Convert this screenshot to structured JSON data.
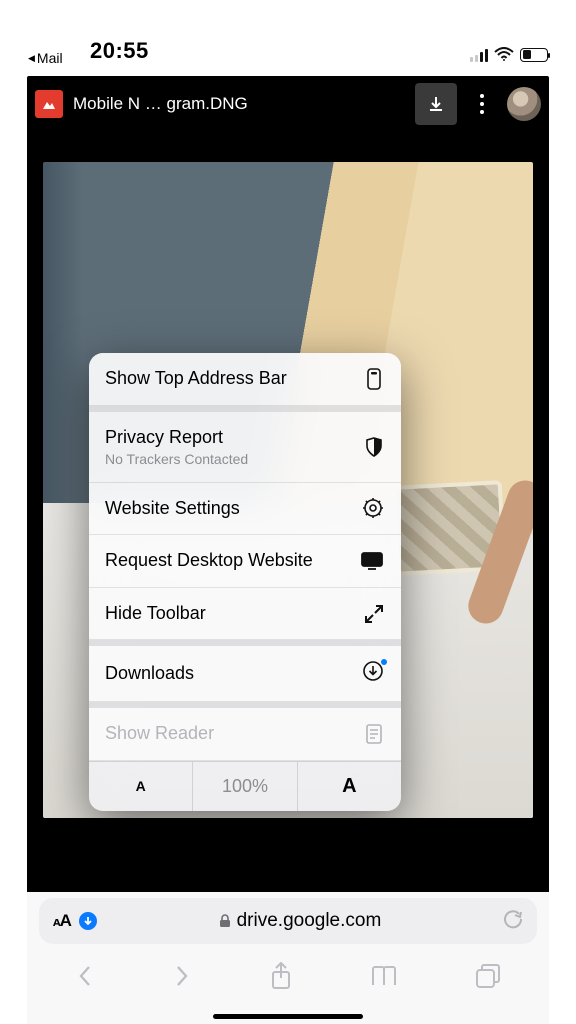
{
  "statusbar": {
    "time": "20:55",
    "back_app": "Mail"
  },
  "drive": {
    "filename": "Mobile N … gram.DNG"
  },
  "menu": {
    "items": [
      {
        "label": "Show Top Address Bar",
        "icon": "address-bar-icon"
      },
      {
        "label": "Privacy Report",
        "sub": "No Trackers Contacted",
        "icon": "shield-icon"
      },
      {
        "label": "Website Settings",
        "icon": "gear-icon"
      },
      {
        "label": "Request Desktop Website",
        "icon": "desktop-icon"
      },
      {
        "label": "Hide Toolbar",
        "icon": "expand-icon"
      },
      {
        "label": "Downloads",
        "icon": "download-circle-icon",
        "badge": true
      },
      {
        "label": "Show Reader",
        "icon": "reader-icon",
        "disabled": true
      }
    ],
    "zoom": {
      "decrease": "A",
      "level": "100%",
      "increase": "A"
    }
  },
  "address": {
    "aa": "ᴀA",
    "domain": "drive.google.com"
  }
}
